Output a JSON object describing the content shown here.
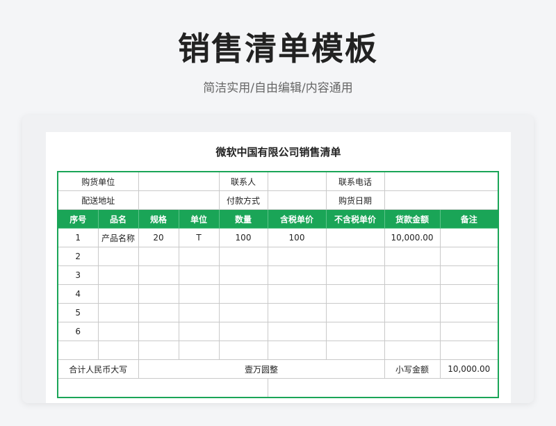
{
  "page": {
    "title": "销售清单模板",
    "subtitle": "简洁实用/自由编辑/内容通用"
  },
  "document": {
    "title": "微软中国有限公司销售清单",
    "info": {
      "buyer_label": "购货单位",
      "contact_label": "联系人",
      "phone_label": "联系电话",
      "address_label": "配送地址",
      "payment_label": "付款方式",
      "date_label": "购货日期"
    },
    "columns": [
      "序号",
      "品名",
      "规格",
      "单位",
      "数量",
      "含税单价",
      "不含税单价",
      "货款金额",
      "备注"
    ],
    "rows": [
      [
        "1",
        "产品名称",
        "20",
        "T",
        "100",
        "100",
        "",
        "10,000.00",
        ""
      ],
      [
        "2",
        "",
        "",
        "",
        "",
        "",
        "",
        "",
        ""
      ],
      [
        "3",
        "",
        "",
        "",
        "",
        "",
        "",
        "",
        ""
      ],
      [
        "4",
        "",
        "",
        "",
        "",
        "",
        "",
        "",
        ""
      ],
      [
        "5",
        "",
        "",
        "",
        "",
        "",
        "",
        "",
        ""
      ],
      [
        "6",
        "",
        "",
        "",
        "",
        "",
        "",
        "",
        ""
      ],
      [
        "",
        "",
        "",
        "",
        "",
        "",
        "",
        "",
        ""
      ]
    ],
    "total": {
      "upper_label": "合计人民币大写",
      "upper_value": "壹万圆整",
      "lower_label": "小写金额",
      "lower_value": "10,000.00"
    }
  }
}
